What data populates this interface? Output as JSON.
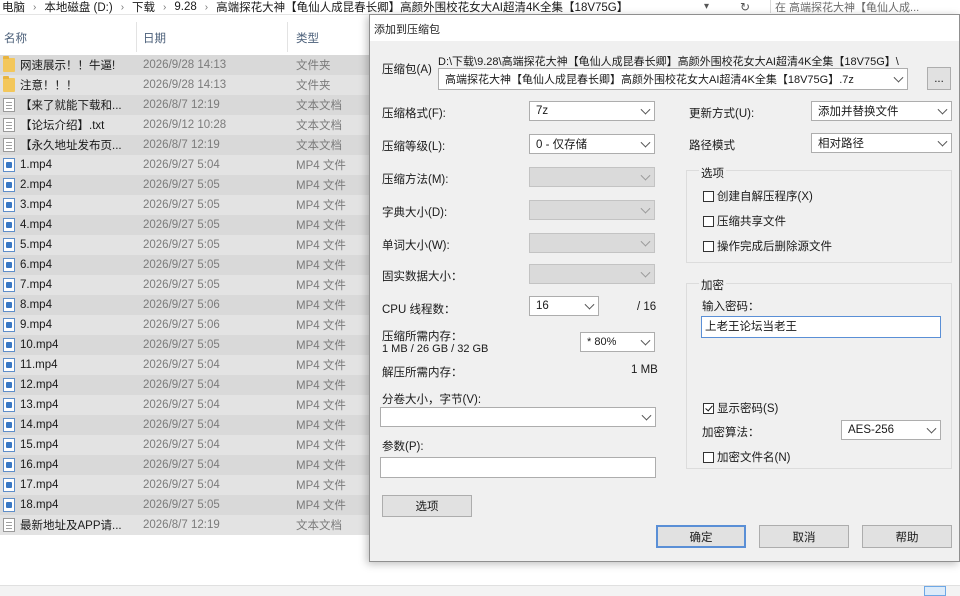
{
  "explorer": {
    "breadcrumb": [
      "电脑",
      "本地磁盘 (D:)",
      "下载",
      "9.28",
      "高端探花大神【龟仙人成昆春长卿】高颜外围校花女大AI超清4K全集【18V75G】"
    ],
    "search_placeholder": "在 高端探花大神【龟仙人成...",
    "columns": {
      "name": "名称",
      "date": "日期",
      "type": "类型"
    },
    "files": [
      {
        "icon": "folder-icon",
        "name": "网速展示！！牛逼!",
        "date": "2026/9/28 14:13",
        "type": "文件夹"
      },
      {
        "icon": "folder-icon",
        "name": "注意！！！",
        "date": "2026/9/28 14:13",
        "type": "文件夹"
      },
      {
        "icon": "text-file-icon",
        "name": "【来了就能下载和...",
        "date": "2026/8/7 12:19",
        "type": "文本文档"
      },
      {
        "icon": "text-file-icon",
        "name": "【论坛介绍】.txt",
        "date": "2026/9/12 10:28",
        "type": "文本文档"
      },
      {
        "icon": "text-file-icon",
        "name": "【永久地址发布页...",
        "date": "2026/8/7 12:19",
        "type": "文本文档"
      },
      {
        "icon": "video-file-icon",
        "name": "1.mp4",
        "date": "2026/9/27 5:04",
        "type": "MP4 文件"
      },
      {
        "icon": "video-file-icon",
        "name": "2.mp4",
        "date": "2026/9/27 5:05",
        "type": "MP4 文件"
      },
      {
        "icon": "video-file-icon",
        "name": "3.mp4",
        "date": "2026/9/27 5:05",
        "type": "MP4 文件"
      },
      {
        "icon": "video-file-icon",
        "name": "4.mp4",
        "date": "2026/9/27 5:05",
        "type": "MP4 文件"
      },
      {
        "icon": "video-file-icon",
        "name": "5.mp4",
        "date": "2026/9/27 5:05",
        "type": "MP4 文件"
      },
      {
        "icon": "video-file-icon",
        "name": "6.mp4",
        "date": "2026/9/27 5:05",
        "type": "MP4 文件"
      },
      {
        "icon": "video-file-icon",
        "name": "7.mp4",
        "date": "2026/9/27 5:05",
        "type": "MP4 文件"
      },
      {
        "icon": "video-file-icon",
        "name": "8.mp4",
        "date": "2026/9/27 5:06",
        "type": "MP4 文件"
      },
      {
        "icon": "video-file-icon",
        "name": "9.mp4",
        "date": "2026/9/27 5:06",
        "type": "MP4 文件"
      },
      {
        "icon": "video-file-icon",
        "name": "10.mp4",
        "date": "2026/9/27 5:05",
        "type": "MP4 文件"
      },
      {
        "icon": "video-file-icon",
        "name": "11.mp4",
        "date": "2026/9/27 5:04",
        "type": "MP4 文件"
      },
      {
        "icon": "video-file-icon",
        "name": "12.mp4",
        "date": "2026/9/27 5:04",
        "type": "MP4 文件"
      },
      {
        "icon": "video-file-icon",
        "name": "13.mp4",
        "date": "2026/9/27 5:04",
        "type": "MP4 文件"
      },
      {
        "icon": "video-file-icon",
        "name": "14.mp4",
        "date": "2026/9/27 5:04",
        "type": "MP4 文件"
      },
      {
        "icon": "video-file-icon",
        "name": "15.mp4",
        "date": "2026/9/27 5:04",
        "type": "MP4 文件"
      },
      {
        "icon": "video-file-icon",
        "name": "16.mp4",
        "date": "2026/9/27 5:04",
        "type": "MP4 文件"
      },
      {
        "icon": "video-file-icon",
        "name": "17.mp4",
        "date": "2026/9/27 5:04",
        "type": "MP4 文件"
      },
      {
        "icon": "video-file-icon",
        "name": "18.mp4",
        "date": "2026/9/27 5:05",
        "type": "MP4 文件"
      },
      {
        "icon": "text-file-icon",
        "name": "最新地址及APP请...",
        "date": "2026/8/7 12:19",
        "type": "文本文档"
      }
    ]
  },
  "dialog": {
    "title": "添加到压缩包",
    "archive_label": "压缩包(A)",
    "archive_path": "D:\\下载\\9.28\\高端探花大神【龟仙人成昆春长卿】高颜外围校花女大AI超清4K全集【18V75G】\\",
    "archive_name": "高端探花大神【龟仙人成昆春长卿】高颜外围校花女大AI超清4K全集【18V75G】.7z",
    "browse_label": "...",
    "format_label": "压缩格式(F):",
    "format_value": "7z",
    "level_label": "压缩等级(L):",
    "level_value": "0 - 仅存储",
    "method_label": "压缩方法(M):",
    "dict_label": "字典大小(D):",
    "word_label": "单词大小(W):",
    "solid_label": "固实数据大小：",
    "cpu_label": "CPU 线程数：",
    "cpu_value": "16",
    "cpu_total": "/ 16",
    "mem_compress_label": "压缩所需内存：",
    "mem_compress_value": "1 MB / 26 GB / 32 GB",
    "mem_percent": "* 80%",
    "mem_decompress_label": "解压所需内存：",
    "mem_decompress_value": "1 MB",
    "split_label": "分卷大小，字节(V):",
    "params_label": "参数(P):",
    "options_button": "选项",
    "update_label": "更新方式(U):",
    "update_value": "添加并替换文件",
    "path_mode_label": "路径模式",
    "path_mode_value": "相对路径",
    "options_group": "选项",
    "opt_sfx": "创建自解压程序(X)",
    "opt_shared": "压缩共享文件",
    "opt_delete": "操作完成后删除源文件",
    "encryption_group": "加密",
    "password_label": "输入密码：",
    "password_value": "上老王论坛当老王",
    "show_password": "显示密码(S)",
    "enc_method_label": "加密算法：",
    "enc_method_value": "AES-256",
    "encrypt_names": "加密文件名(N)",
    "ok": "确定",
    "cancel": "取消",
    "help": "帮助"
  }
}
